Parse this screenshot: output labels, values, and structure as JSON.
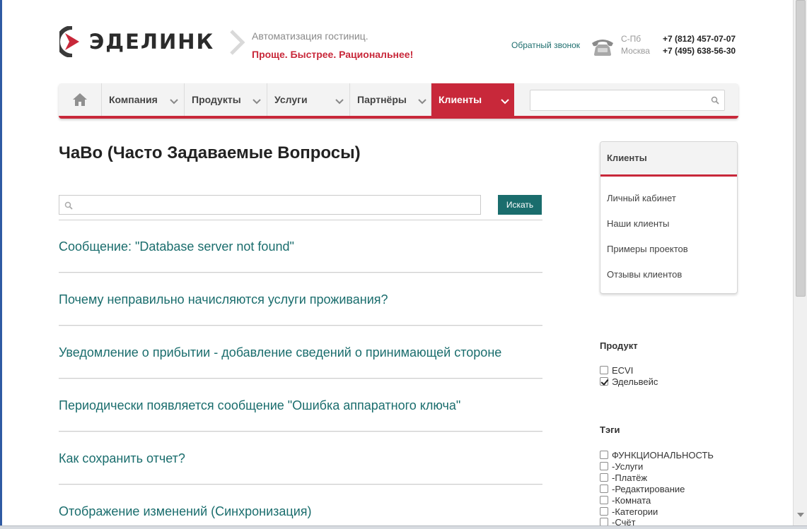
{
  "header": {
    "logo_text": "ЭДЕЛИНК",
    "tagline_primary": "Автоматизация гостиниц.",
    "tagline_secondary": "Проще. Быстрее. Рациональнее!",
    "callback_label": "Обратный звонок",
    "contacts": [
      {
        "city": "С-Пб",
        "phone": "+7 (812) 457-07-07"
      },
      {
        "city": "Москва",
        "phone": "+7 (495) 638-56-30"
      }
    ]
  },
  "nav": {
    "items": [
      {
        "label": "Компания"
      },
      {
        "label": "Продукты"
      },
      {
        "label": "Услуги"
      },
      {
        "label": "Партнёры"
      },
      {
        "label": "Клиенты",
        "active": true
      }
    ],
    "search_placeholder": ""
  },
  "main": {
    "title": "ЧаВо (Часто Задаваемые Вопросы)",
    "search_placeholder": "",
    "search_button": "Искать",
    "faq": [
      "Сообщение: \"Database server not found\"",
      "Почему неправильно начисляются услуги проживания?",
      "Уведомление о прибытии - добавление сведений о принимающей стороне",
      "Периодически появляется сообщение \"Ошибка аппаратного ключа\"",
      "Как сохранить отчет?",
      "Отображение изменений (Синхронизация)"
    ]
  },
  "sidebar": {
    "title": "Клиенты",
    "links": [
      "Личный кабинет",
      "Наши клиенты",
      "Примеры проектов",
      "Отзывы клиентов"
    ],
    "product_filter": {
      "title": "Продукт",
      "options": [
        {
          "label": "ECVI",
          "checked": false
        },
        {
          "label": "Эдельвейс",
          "checked": true
        }
      ]
    },
    "tag_filter": {
      "title": "Тэги",
      "options": [
        {
          "label": "ФУНКЦИОНАЛЬНОСТЬ",
          "checked": false
        },
        {
          "label": "-Услуги",
          "checked": false
        },
        {
          "label": "-Платёж",
          "checked": false
        },
        {
          "label": "-Редактирование",
          "checked": false
        },
        {
          "label": "-Комната",
          "checked": false
        },
        {
          "label": "-Категории",
          "checked": false
        },
        {
          "label": "-Счёт",
          "checked": false
        }
      ]
    }
  },
  "colors": {
    "brand_red": "#c8283a",
    "link_teal": "#1a6d6d",
    "button_teal": "#1a6d6d"
  }
}
